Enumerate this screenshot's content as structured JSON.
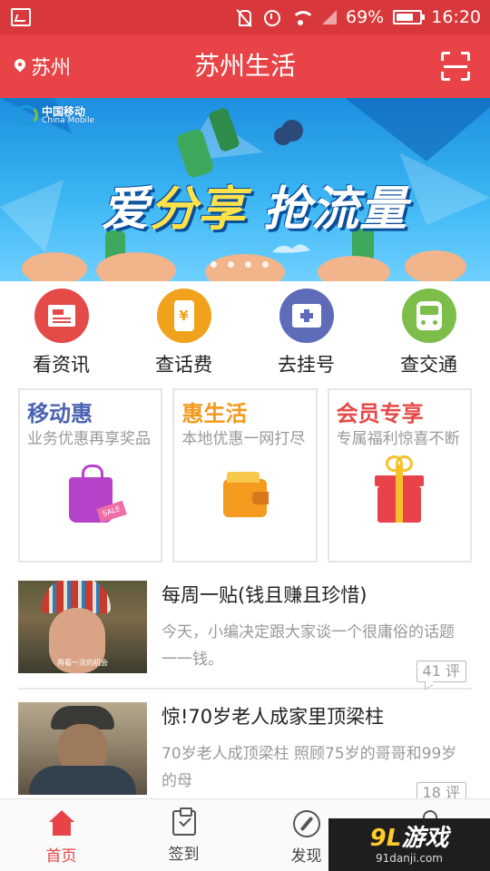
{
  "status_bar": {
    "battery_percent": "69%",
    "time": "16:20",
    "icons": [
      "gallery-icon",
      "mute-icon",
      "alarm-icon",
      "wifi-icon",
      "signal-icon",
      "battery-icon"
    ]
  },
  "header": {
    "location": "苏州",
    "title": "苏州生活",
    "scan_icon": "scan-icon"
  },
  "banner": {
    "brand_cn": "中国移动",
    "brand_en": "China Mobile",
    "slogan_part1": "爱",
    "slogan_part2": "分享",
    "slogan_part3": " 抢流量",
    "page_count": 4,
    "active_index": 0
  },
  "quick_entries": [
    {
      "label": "看资讯",
      "icon": "news-icon",
      "color": "#e34a48"
    },
    {
      "label": "查话费",
      "icon": "phone-bill-icon",
      "color": "#f0a21c"
    },
    {
      "label": "去挂号",
      "icon": "hospital-icon",
      "color": "#5d6bb8"
    },
    {
      "label": "查交通",
      "icon": "bus-icon",
      "color": "#7dbd4a"
    }
  ],
  "promo_cards": [
    {
      "title": "移动惠",
      "desc": "业务优惠再享奖品",
      "title_color": "#4c63b0",
      "icon": "shopping-bag-icon"
    },
    {
      "title": "惠生活",
      "desc": "本地优惠一网打尽",
      "title_color": "#f29a1d",
      "icon": "wallet-icon"
    },
    {
      "title": "会员专享",
      "desc": "专属福利惊喜不断",
      "title_color": "#e34a48",
      "icon": "gift-icon"
    }
  ],
  "articles": [
    {
      "title": "每周一贴(钱且赚且珍惜)",
      "summary": "今天，小编决定跟大家谈一个很庸俗的话题一一钱。",
      "comments": "41 评",
      "thumb_caption": "再看一次的机会"
    },
    {
      "title": "惊!70岁老人成家里顶梁柱",
      "summary": "70岁老人成顶梁柱 照顾75岁的哥哥和99岁的母",
      "comments": "18 评"
    }
  ],
  "bottom_nav": [
    {
      "label": "首页",
      "icon": "home-icon",
      "active": true
    },
    {
      "label": "签到",
      "icon": "checkin-icon",
      "active": false
    },
    {
      "label": "发现",
      "icon": "compass-icon",
      "active": false
    },
    {
      "label": "",
      "icon": "profile-icon",
      "active": false
    }
  ],
  "watermark": {
    "num": "9L",
    "text": "游戏",
    "site": "91danji.com"
  },
  "colors": {
    "primary": "#e84447",
    "status_bar": "#d8383b"
  }
}
